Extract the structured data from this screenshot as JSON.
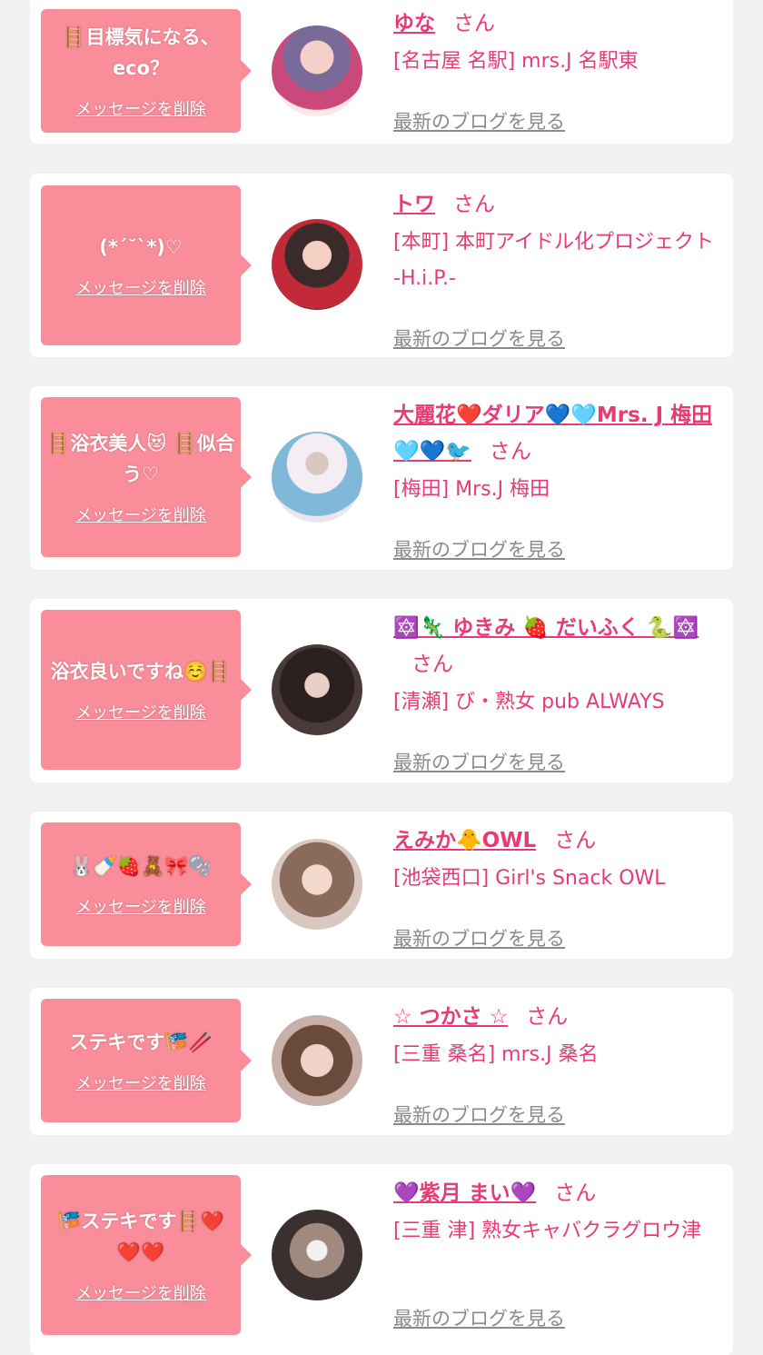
{
  "delete_label": "メッセージを削除",
  "blog_label": "最新のブログを見る",
  "san_label": "さん",
  "colors": {
    "accent": "#e83a73",
    "bubble": "#f98d9a",
    "link_gray": "#8a8a8a",
    "page_bg": "#f1f1f1"
  },
  "messages": [
    {
      "text": "🪜目標気になる、eco？",
      "name": "ゆな",
      "shop": "[名古屋 名駅] mrs.J 名駅東"
    },
    {
      "text": "(*´˘`*)♡",
      "name": "トワ",
      "shop": "[本町] 本町アイドル化プロジェクト -H.i.P.-"
    },
    {
      "text": "🪜浴衣美人😻 🪜似合う♡",
      "name": "大麗花❤️ダリア💙🩵Mrs. J 梅田🩵💙🐦",
      "shop": "[梅田] Mrs.J 梅田"
    },
    {
      "text": "浴衣良いですね☺️🪜",
      "name": "🔯🦎 ゆきみ 🍓 だいふく 🐍🔯",
      "shop": "[清瀬] び・熟女 pub ALWAYS"
    },
    {
      "text": "🐰🍼🍓🧸🎀🫧",
      "name": "えみか🐥OWL",
      "shop": "[池袋西口] Girl's Snack OWL"
    },
    {
      "text": "ステキです🎏🥢",
      "name": "☆ つかさ ☆",
      "shop": "[三重 桑名] mrs.J 桑名"
    },
    {
      "text": "🎏ステキです🪜❤️❤️❤️",
      "name": "💜紫月 まい💜",
      "shop": "[三重 津] 熟女キャバクラグロウ津"
    }
  ]
}
